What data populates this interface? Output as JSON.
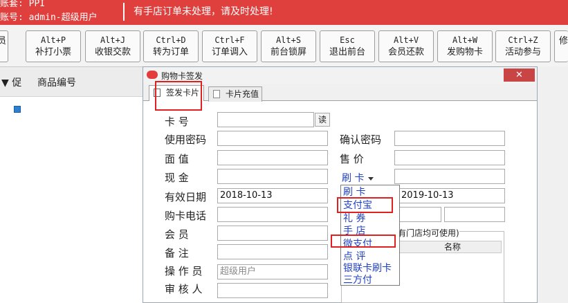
{
  "topbar": {
    "account_line": "账套: PPI",
    "user_line": "账号: admin-超级用户",
    "notice": "有手店订单未处理，请及时处理!"
  },
  "toolbar": {
    "buttons": [
      {
        "key": "",
        "label": "员"
      },
      {
        "key": "Alt+P",
        "label": "补打小票"
      },
      {
        "key": "Alt+J",
        "label": "收银交款"
      },
      {
        "key": "Ctrl+D",
        "label": "转为订单"
      },
      {
        "key": "Ctrl+F",
        "label": "订单调入"
      },
      {
        "key": "Alt+S",
        "label": "前台锁屏"
      },
      {
        "key": "Esc",
        "label": "退出前台"
      },
      {
        "key": "Alt+V",
        "label": "会员还款"
      },
      {
        "key": "Alt+W",
        "label": "发购物卡"
      },
      {
        "key": "Ctrl+Z",
        "label": "活动参与"
      },
      {
        "key": "",
        "label": "修"
      }
    ]
  },
  "grid": {
    "col_promo": "▼ 促",
    "col_code": "商品编号"
  },
  "dialog": {
    "title": "购物卡签发",
    "close_label": "✕",
    "tabs": [
      {
        "label": "签发卡片"
      },
      {
        "label": "卡片充值"
      }
    ],
    "labels": {
      "card_no": "卡        号",
      "password": "使用密码",
      "face_value": "面        值",
      "cash": "现        金",
      "valid_date": "有效日期",
      "phone": "购卡电话",
      "member": "会        员",
      "remark": "备        注",
      "operator": "操  作  员",
      "auditor": "审  核  人",
      "confirm_password": "确认密码",
      "sale_price": "售        价"
    },
    "read_button": "读",
    "values": {
      "valid_date": "2018-10-13",
      "end_date": "2019-10-13",
      "operator_placeholder": "超级用户"
    },
    "payment": {
      "selected": "刷    卡",
      "options": [
        "刷    卡",
        "支付宝",
        "礼    券",
        "手    店",
        "微支付",
        "点    评",
        "银联卡刷卡",
        "三方付"
      ]
    },
    "store_panel": {
      "title": "有门店均可使用)",
      "header_name": "名称"
    }
  }
}
